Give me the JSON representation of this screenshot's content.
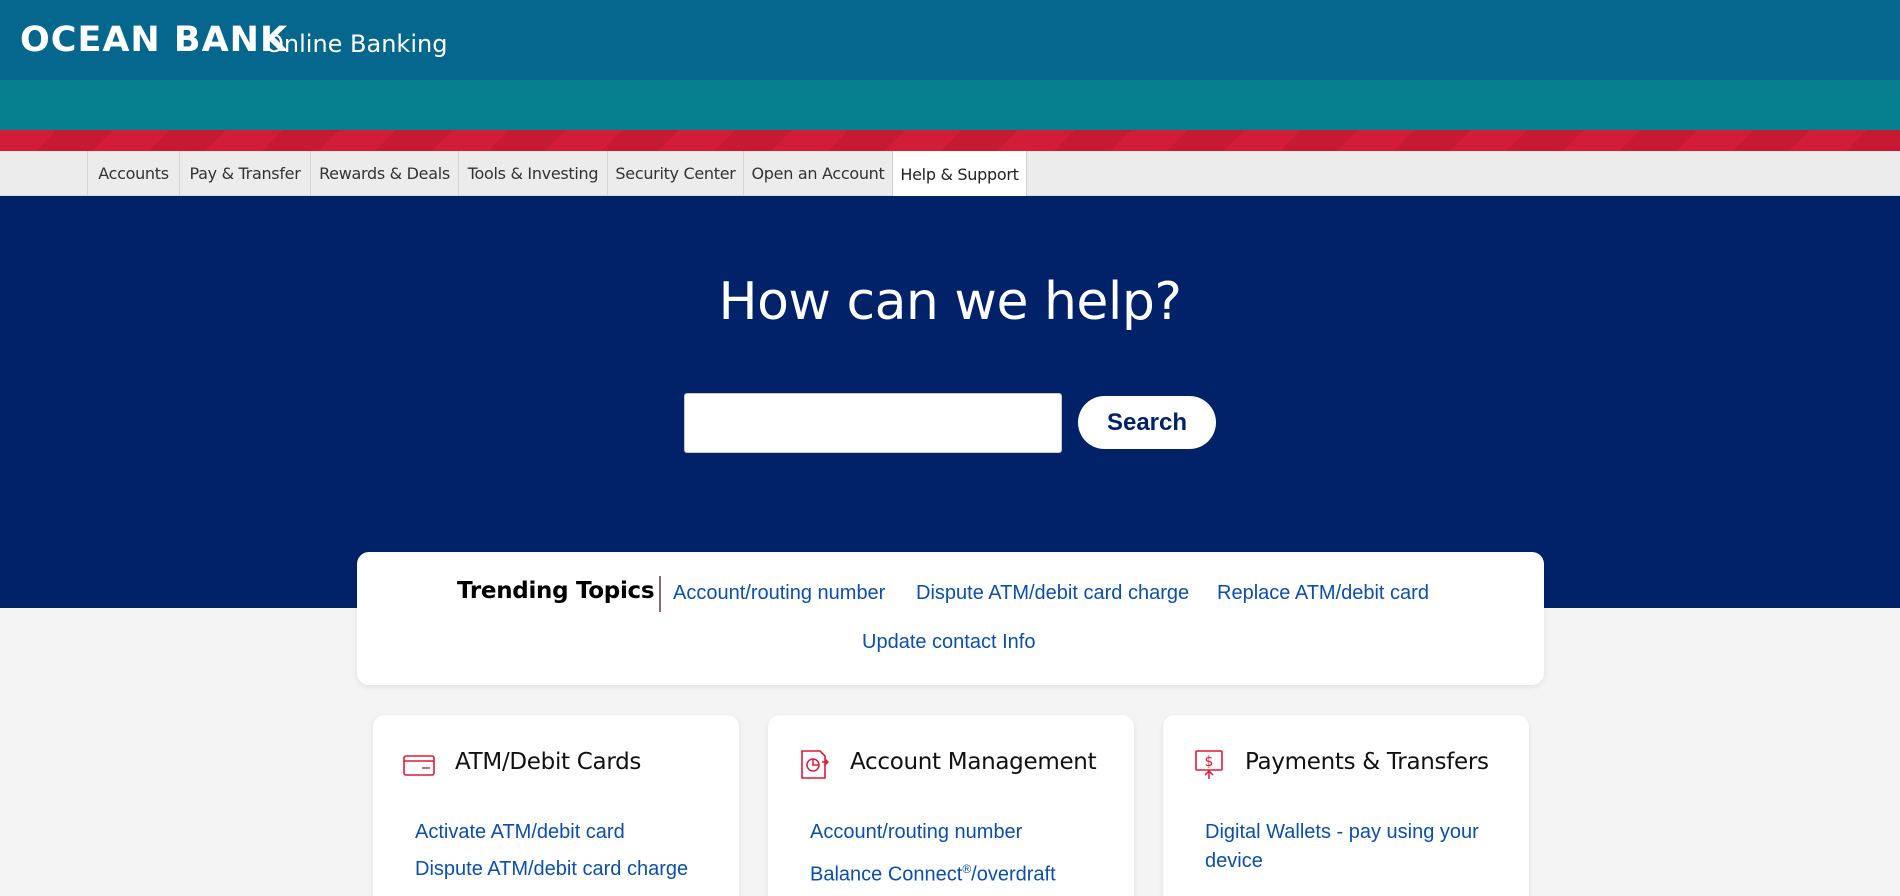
{
  "header": {
    "brand": "OCEAN BANK",
    "subtitle": "Online Banking"
  },
  "nav": {
    "tabs": [
      {
        "label": "Accounts",
        "active": false
      },
      {
        "label": "Pay & Transfer",
        "active": false
      },
      {
        "label": "Rewards & Deals",
        "active": false
      },
      {
        "label": "Tools & Investing",
        "active": false
      },
      {
        "label": "Security Center",
        "active": false
      },
      {
        "label": "Open an Account",
        "active": false
      },
      {
        "label": "Help & Support",
        "active": true
      }
    ]
  },
  "hero": {
    "title": "How can we help?",
    "search_value": "",
    "search_button": "Search"
  },
  "trending": {
    "title": "Trending Topics",
    "links": [
      "Account/routing number",
      "Dispute ATM/debit card charge",
      "Replace ATM/debit card",
      "Update contact Info"
    ]
  },
  "cards": [
    {
      "icon": "debit-card-icon",
      "title": "ATM/Debit Cards",
      "links": [
        "Activate ATM/debit card",
        "Dispute ATM/debit card charge"
      ]
    },
    {
      "icon": "account-management-icon",
      "title": "Account Management",
      "links": [
        "Account/routing number",
        "Balance Connect",
        "®",
        "/overdraft"
      ]
    },
    {
      "icon": "payments-transfers-icon",
      "title": "Payments & Transfers",
      "links": [
        "Digital Wallets - pay using your device"
      ]
    }
  ],
  "colors": {
    "topbar": "#05678d",
    "tealbar": "#06808e",
    "redbar": "#d31c38",
    "hero": "#012169",
    "link": "#0a4fae",
    "icon_accent": "#e31837"
  }
}
